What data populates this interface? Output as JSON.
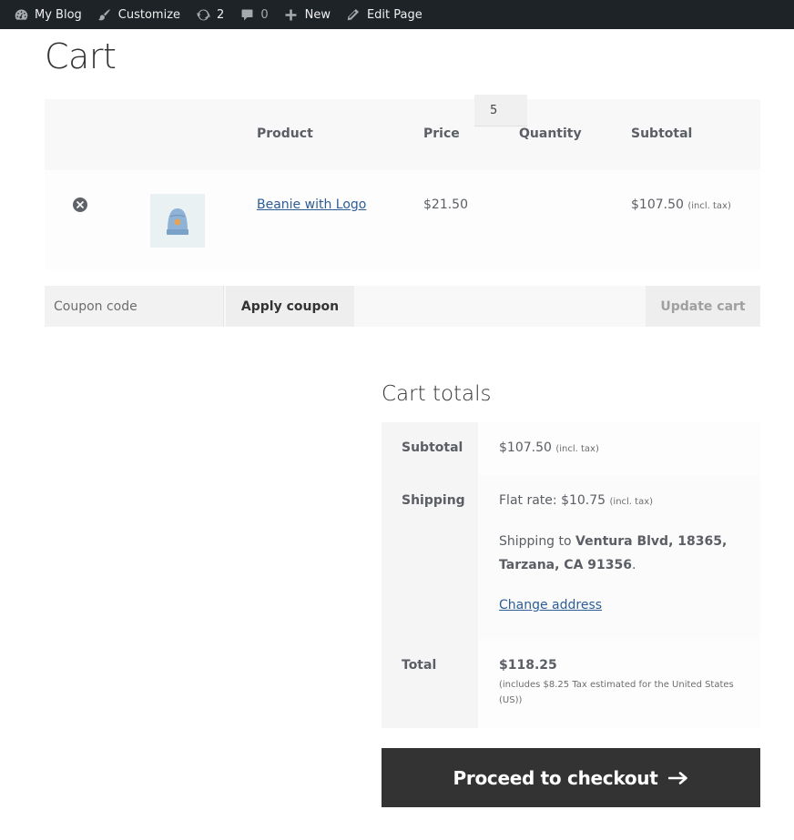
{
  "adminbar": {
    "site_name": "My Blog",
    "customize": "Customize",
    "updates_count": "2",
    "comments_count": "0",
    "new_label": "New",
    "edit_page": "Edit Page"
  },
  "page": {
    "title": "Cart"
  },
  "cart": {
    "headers": {
      "product": "Product",
      "price": "Price",
      "quantity": "Quantity",
      "subtotal": "Subtotal"
    },
    "item": {
      "name": "Beanie with Logo",
      "price": "$21.50",
      "quantity": "5",
      "subtotal": "$107.50",
      "tax_note": "(incl. tax)"
    }
  },
  "actions": {
    "coupon_placeholder": "Coupon code",
    "apply_coupon": "Apply coupon",
    "update_cart": "Update cart"
  },
  "totals": {
    "title": "Cart totals",
    "subtotal_label": "Subtotal",
    "subtotal_value": "$107.50",
    "subtotal_tax_note": "(incl. tax)",
    "shipping_label": "Shipping",
    "shipping_rate": "Flat rate: $10.75",
    "shipping_tax_note": "(incl. tax)",
    "shipping_to_prefix": "Shipping to",
    "shipping_address": "Ventura Blvd, 18365, Tarzana, CA 91356",
    "shipping_to_suffix": ".",
    "change_address": "Change address",
    "total_label": "Total",
    "total_value": "$118.25",
    "total_note": "(includes $8.25 Tax estimated for the United States (US))"
  },
  "checkout": {
    "label": "Proceed to checkout"
  },
  "colors": {
    "adminbar": "#1d2327",
    "link": "#2c5d95",
    "checkout": "#333333"
  }
}
